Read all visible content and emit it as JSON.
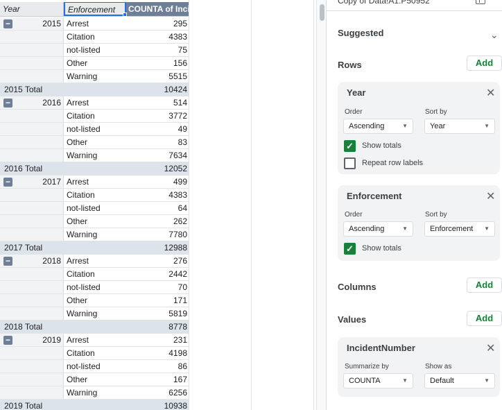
{
  "header": {
    "col_year": "Year",
    "col_enforcement": "Enforcement",
    "col_value": "COUNTA of Incid"
  },
  "years": [
    {
      "year": "2015",
      "total_label": "2015 Total",
      "total": "10424",
      "rows": [
        {
          "type": "Arrest",
          "count": "295"
        },
        {
          "type": "Citation",
          "count": "4383"
        },
        {
          "type": "not-listed",
          "count": "75"
        },
        {
          "type": "Other",
          "count": "156"
        },
        {
          "type": "Warning",
          "count": "5515"
        }
      ]
    },
    {
      "year": "2016",
      "total_label": "2016 Total",
      "total": "12052",
      "rows": [
        {
          "type": "Arrest",
          "count": "514"
        },
        {
          "type": "Citation",
          "count": "3772"
        },
        {
          "type": "not-listed",
          "count": "49"
        },
        {
          "type": "Other",
          "count": "83"
        },
        {
          "type": "Warning",
          "count": "7634"
        }
      ]
    },
    {
      "year": "2017",
      "total_label": "2017 Total",
      "total": "12988",
      "rows": [
        {
          "type": "Arrest",
          "count": "499"
        },
        {
          "type": "Citation",
          "count": "4383"
        },
        {
          "type": "not-listed",
          "count": "64"
        },
        {
          "type": "Other",
          "count": "262"
        },
        {
          "type": "Warning",
          "count": "7780"
        }
      ]
    },
    {
      "year": "2018",
      "total_label": "2018 Total",
      "total": "8778",
      "rows": [
        {
          "type": "Arrest",
          "count": "276"
        },
        {
          "type": "Citation",
          "count": "2442"
        },
        {
          "type": "not-listed",
          "count": "70"
        },
        {
          "type": "Other",
          "count": "171"
        },
        {
          "type": "Warning",
          "count": "5819"
        }
      ]
    },
    {
      "year": "2019",
      "total_label": "2019 Total",
      "total": "10938",
      "rows": [
        {
          "type": "Arrest",
          "count": "231"
        },
        {
          "type": "Citation",
          "count": "4198"
        },
        {
          "type": "not-listed",
          "count": "86"
        },
        {
          "type": "Other",
          "count": "167"
        },
        {
          "type": "Warning",
          "count": "6256"
        }
      ]
    }
  ],
  "collapse_glyph": "−",
  "panel": {
    "range_text": "Copy of Data!A1:P50952",
    "suggested": "Suggested",
    "rows_title": "Rows",
    "add_label": "Add",
    "columns_title": "Columns",
    "values_title": "Values",
    "close_glyph": "✕",
    "check_glyph": "✓",
    "dropdown_glyph": "▼",
    "chevron_glyph": "⌄",
    "row_fields": [
      {
        "name": "Year",
        "order_label": "Order",
        "order_value": "Ascending",
        "sortby_label": "Sort by",
        "sortby_value": "Year",
        "show_totals": "Show totals",
        "repeat_labels": "Repeat row labels"
      },
      {
        "name": "Enforcement",
        "order_label": "Order",
        "order_value": "Ascending",
        "sortby_label": "Sort by",
        "sortby_value": "Enforcement",
        "show_totals": "Show totals"
      }
    ],
    "value_field": {
      "name": "IncidentNumber",
      "summarize_label": "Summarize by",
      "summarize_value": "COUNTA",
      "showas_label": "Show as",
      "showas_value": "Default"
    }
  },
  "colors": {
    "accent_green": "#188038",
    "header_value_bg": "#6f7f97",
    "total_row_bg": "#dde3ea",
    "selection_blue": "#1a73e8"
  }
}
